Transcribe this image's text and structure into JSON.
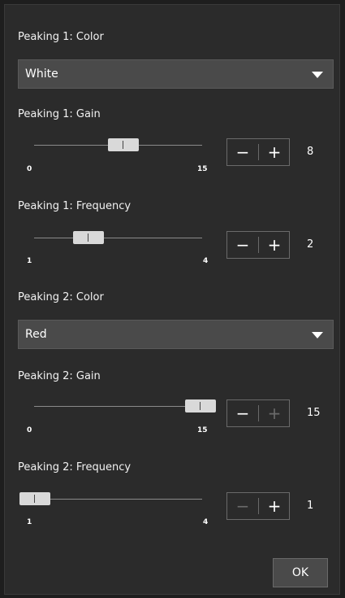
{
  "peaking1": {
    "color_label": "Peaking 1: Color",
    "color_value": "White",
    "gain_label": "Peaking 1: Gain",
    "gain_min": "0",
    "gain_max": "15",
    "gain_value": "8",
    "freq_label": "Peaking 1: Frequency",
    "freq_min": "1",
    "freq_max": "4",
    "freq_value": "2"
  },
  "peaking2": {
    "color_label": "Peaking 2: Color",
    "color_value": "Red",
    "gain_label": "Peaking 2: Gain",
    "gain_min": "0",
    "gain_max": "15",
    "gain_value": "15",
    "freq_label": "Peaking 2: Frequency",
    "freq_min": "1",
    "freq_max": "4",
    "freq_value": "1"
  },
  "stepper": {
    "minus": "−",
    "plus": "+"
  },
  "ok_label": "OK"
}
